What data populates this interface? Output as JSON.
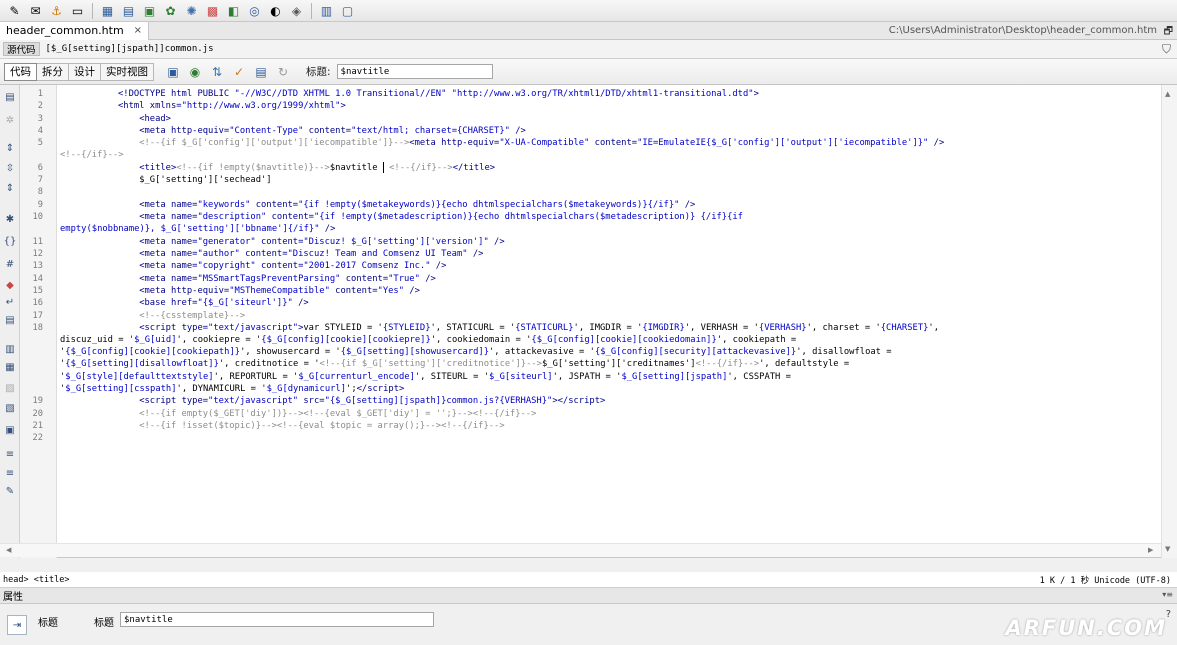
{
  "window": {
    "tab_name": "header_common.htm",
    "tab_close": "×",
    "file_path": "C:\\Users\\Administrator\\Desktop\\header_common.htm",
    "restore_glyph": "🗗"
  },
  "related_bar": {
    "source_button": "源代码",
    "related_file": "[$_G[setting][jspath]]common.js"
  },
  "doc_toolbar": {
    "views": [
      "代码",
      "拆分",
      "设计",
      "实时视图"
    ],
    "title_label": "标题:",
    "title_value": "$navtitle"
  },
  "editor": {
    "line_numbers": [
      "1",
      "2",
      "3",
      "4",
      "5",
      "",
      "6",
      "7",
      "8",
      "9",
      "10",
      "",
      "11",
      "12",
      "13",
      "14",
      "15",
      "16",
      "17",
      "18",
      "",
      "",
      "",
      "",
      "",
      "19",
      "20",
      "21",
      "22"
    ]
  },
  "status": {
    "tag_path": "head> <title>",
    "file_info": "1 K / 1 秒 Unicode (UTF-8)"
  },
  "properties": {
    "header": "属性",
    "tag_label": "标题",
    "title_label": "标题",
    "title_value": "$navtitle",
    "help_glyph": "?"
  },
  "watermark": "ARFUN.COM"
}
